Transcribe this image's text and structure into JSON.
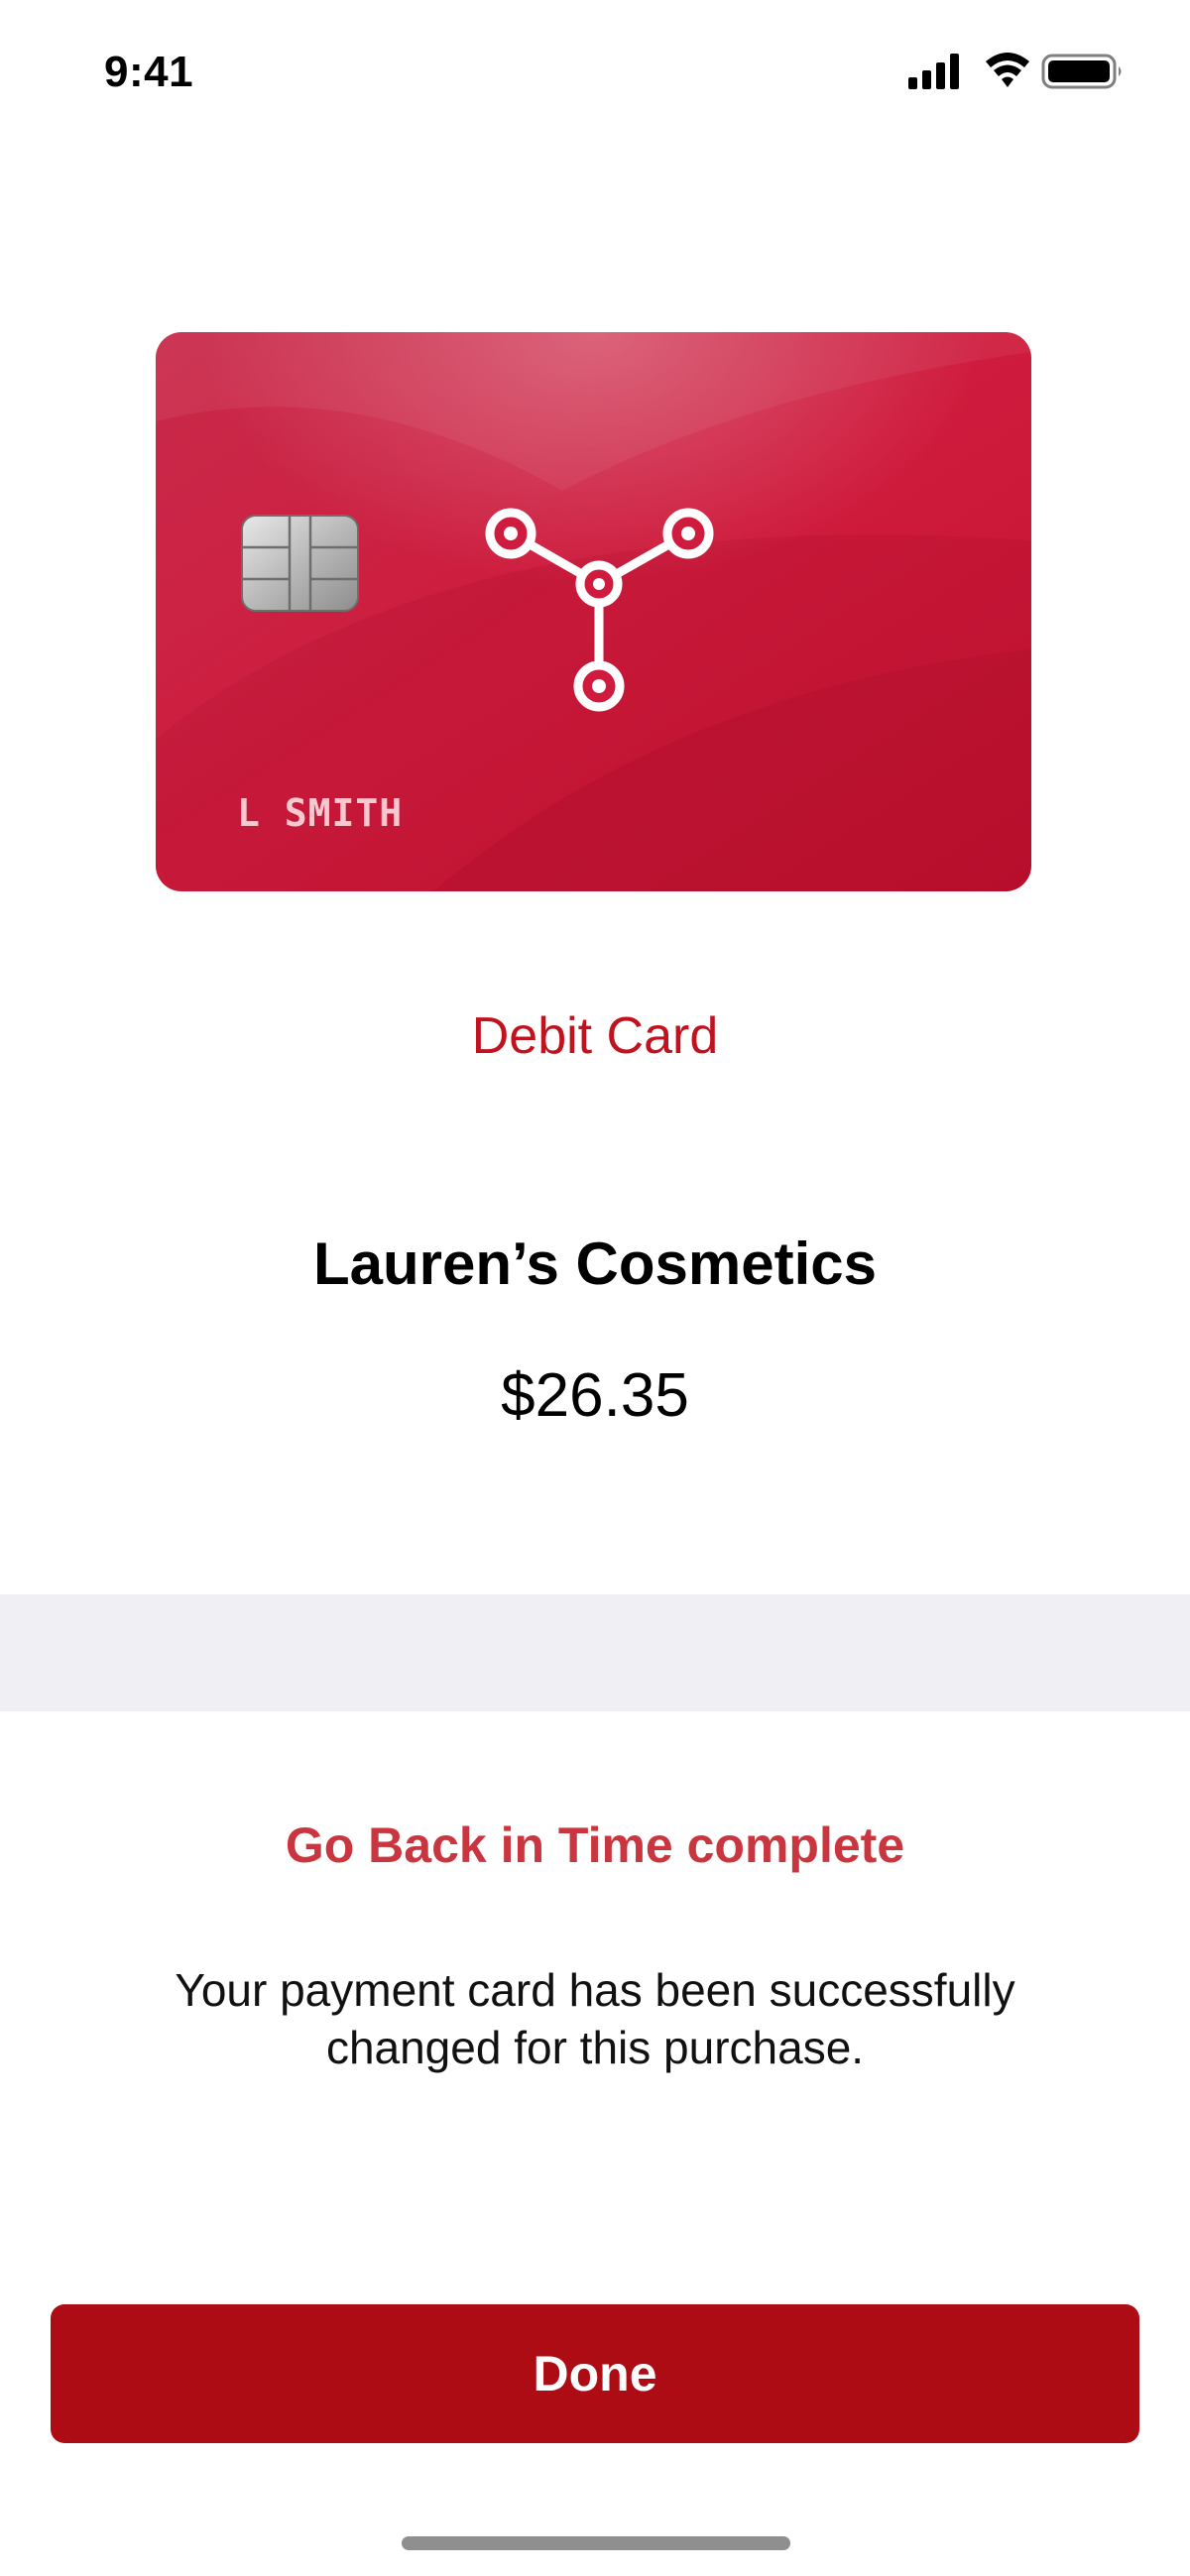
{
  "status_bar": {
    "time": "9:41",
    "icons": [
      "signal-icon",
      "wifi-icon",
      "battery-icon"
    ]
  },
  "card": {
    "holder_name": "L SMITH",
    "brand_color": "#c8173a",
    "icons": [
      "chip-icon",
      "network-logo-icon"
    ]
  },
  "payment": {
    "card_type": "Debit Card",
    "merchant": "Lauren’s Cosmetics",
    "amount": "$26.35"
  },
  "confirmation": {
    "title": "Go Back in Time complete",
    "message": "Your payment card has been successfully changed for this purchase."
  },
  "actions": {
    "done_label": "Done",
    "accent_color": "#ad0c14"
  }
}
